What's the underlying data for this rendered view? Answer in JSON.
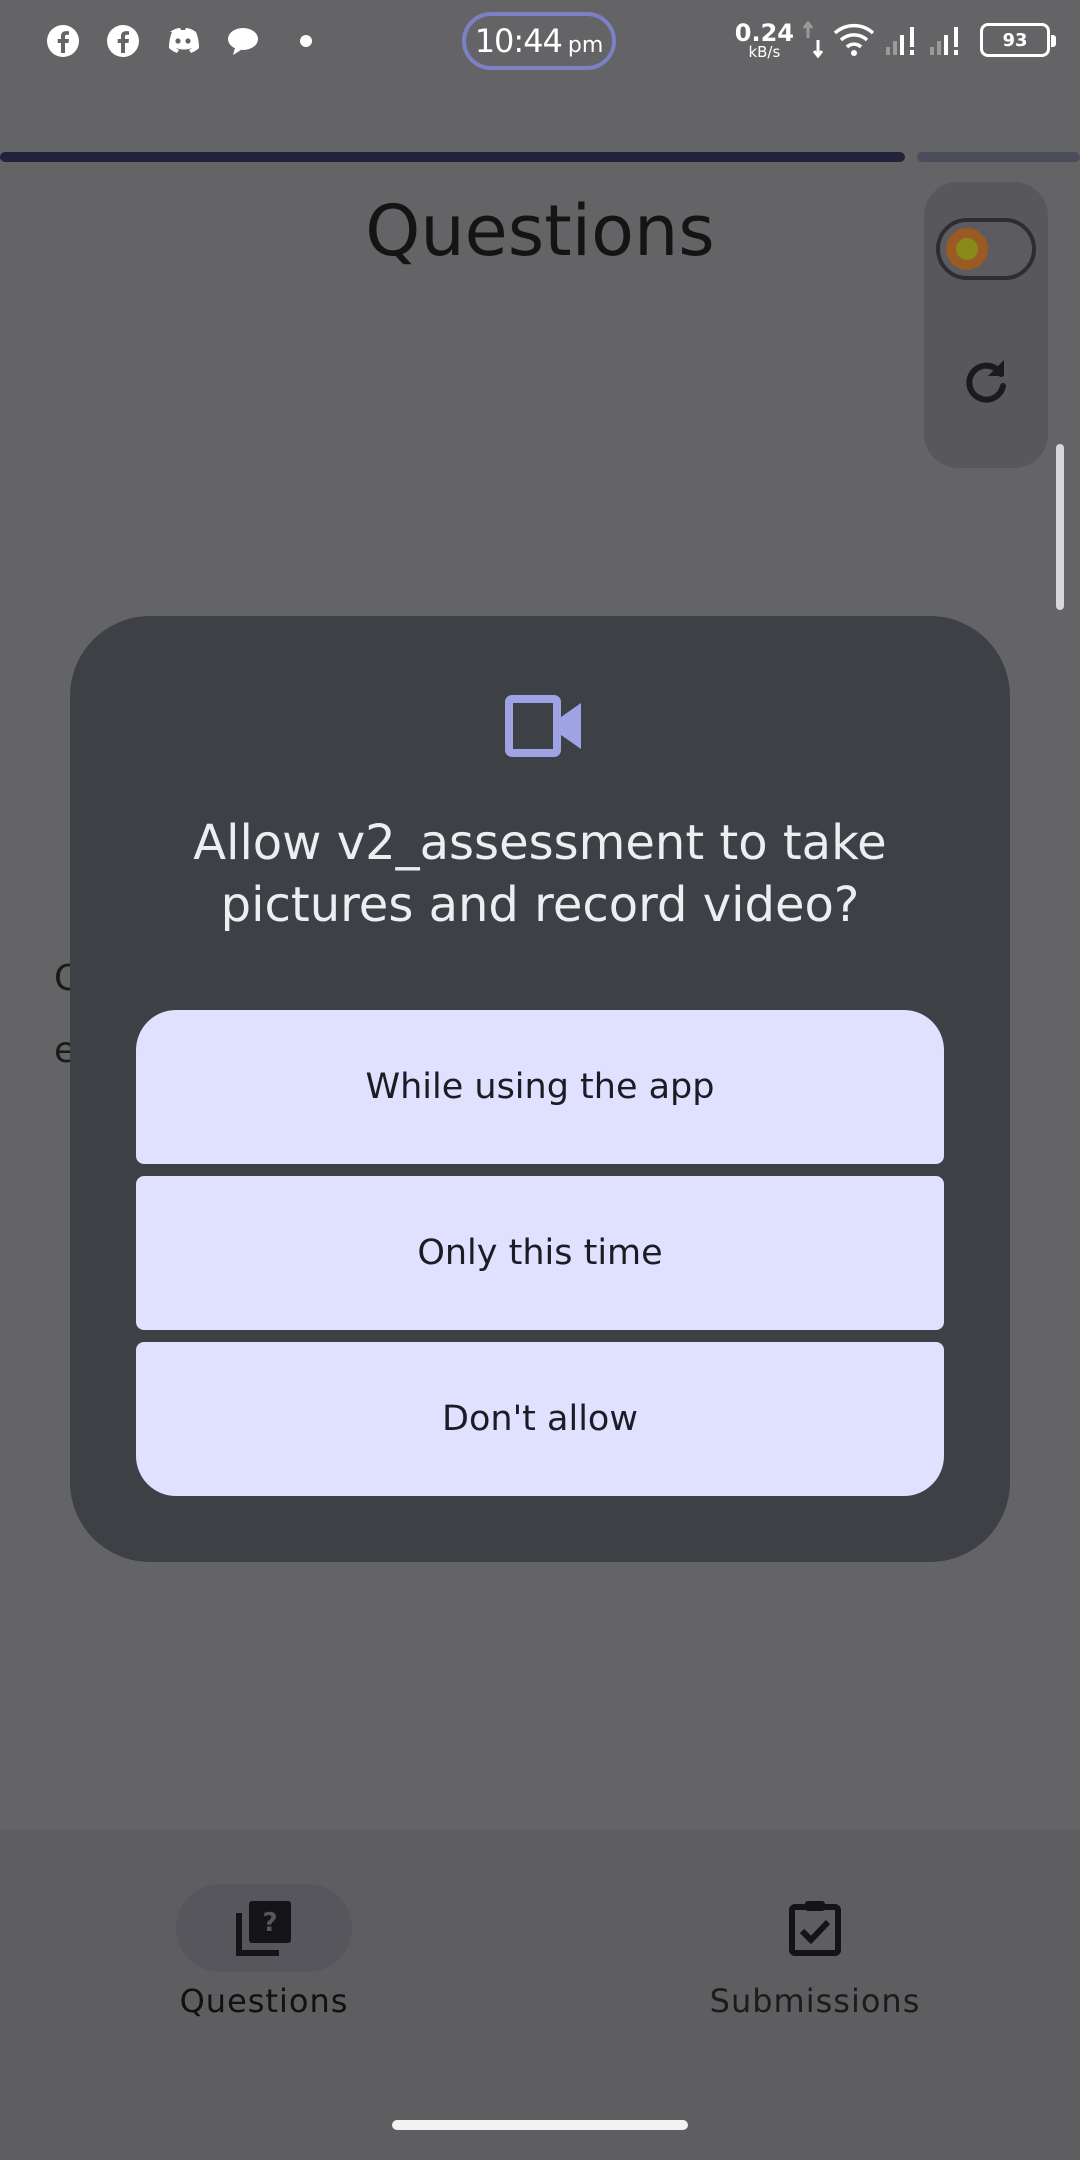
{
  "status_bar": {
    "time": "10:44",
    "ampm": "pm",
    "net_speed": "0.24",
    "net_unit": "kB/s",
    "battery": "93",
    "left_icons": [
      "facebook-icon",
      "facebook-icon",
      "discord-icon",
      "chat-icon"
    ]
  },
  "page": {
    "title": "Questions",
    "progress_fraction": 0.85,
    "bg_fragment_1": "C",
    "bg_fragment_2": "e"
  },
  "dialog": {
    "icon": "video-camera-icon",
    "title": "Allow v2_assessment to take pictures and record video?",
    "options": [
      {
        "label": "While using the app"
      },
      {
        "label": "Only this time"
      },
      {
        "label": "Don't allow"
      }
    ]
  },
  "bottom_nav": {
    "items": [
      {
        "label": "Questions",
        "icon": "questions-icon",
        "selected": true
      },
      {
        "label": "Submissions",
        "icon": "clipboard-check-icon",
        "selected": false
      }
    ]
  },
  "colors": {
    "accent": "#9fa3e6",
    "dialog_bg": "#3d4044",
    "option_bg": "#e0e0ff",
    "scrim_bg": "#646466"
  }
}
